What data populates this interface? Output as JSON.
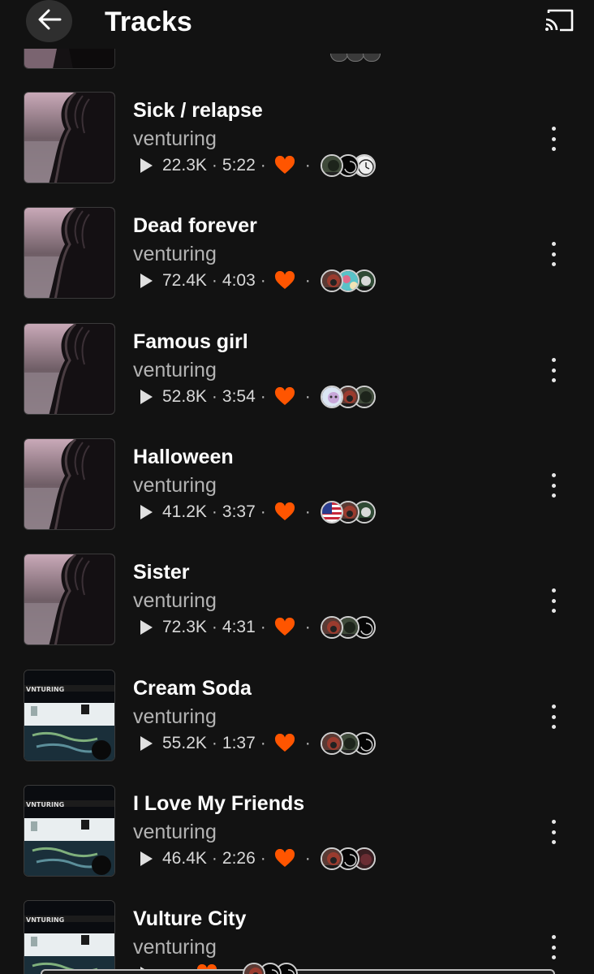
{
  "header": {
    "title": "Tracks",
    "back_icon": "arrow-left-icon",
    "cast_icon": "cast-icon"
  },
  "colors": {
    "background": "#121212",
    "accent_heart": "#ff5500",
    "text_secondary": "#b3b3b3"
  },
  "tracks": [
    {
      "title": "Sick / relapse",
      "artist": "venturing",
      "plays": "22.3K",
      "duration": "5:22",
      "liked": true,
      "art": "dark-portrait",
      "avatars": [
        "green-dark",
        "black-swirl",
        "white-clock"
      ]
    },
    {
      "title": "Dead forever",
      "artist": "venturing",
      "plays": "72.4K",
      "duration": "4:03",
      "liked": true,
      "art": "dark-portrait",
      "avatars": [
        "red-hair",
        "teal-pattern",
        "green-face"
      ]
    },
    {
      "title": "Famous girl",
      "artist": "venturing",
      "plays": "52.8K",
      "duration": "3:54",
      "liked": true,
      "art": "dark-portrait",
      "avatars": [
        "pastel-face",
        "red-hair",
        "green-dark"
      ]
    },
    {
      "title": "Halloween",
      "artist": "venturing",
      "plays": "41.2K",
      "duration": "3:37",
      "liked": true,
      "art": "dark-portrait",
      "avatars": [
        "us-flag",
        "red-hair",
        "green-face"
      ]
    },
    {
      "title": "Sister",
      "artist": "venturing",
      "plays": "72.3K",
      "duration": "4:31",
      "liked": true,
      "art": "dark-portrait",
      "avatars": [
        "red-hair",
        "green-dark",
        "black-swirl"
      ]
    },
    {
      "title": "Cream Soda",
      "artist": "venturing",
      "plays": "55.2K",
      "duration": "1:37",
      "liked": true,
      "art": "night-pool",
      "avatars": [
        "red-hair",
        "green-dark",
        "black-swirl"
      ]
    },
    {
      "title": "I Love My Friends",
      "artist": "venturing",
      "plays": "46.4K",
      "duration": "2:26",
      "liked": true,
      "art": "night-pool",
      "avatars": [
        "red-hair",
        "black-swirl",
        "dark-red"
      ]
    },
    {
      "title": "Vulture City",
      "artist": "venturing",
      "plays": "",
      "duration": "",
      "liked": true,
      "art": "night-pool",
      "avatars": [
        "red-hair",
        "black-swirl",
        "black-swirl"
      ]
    }
  ]
}
